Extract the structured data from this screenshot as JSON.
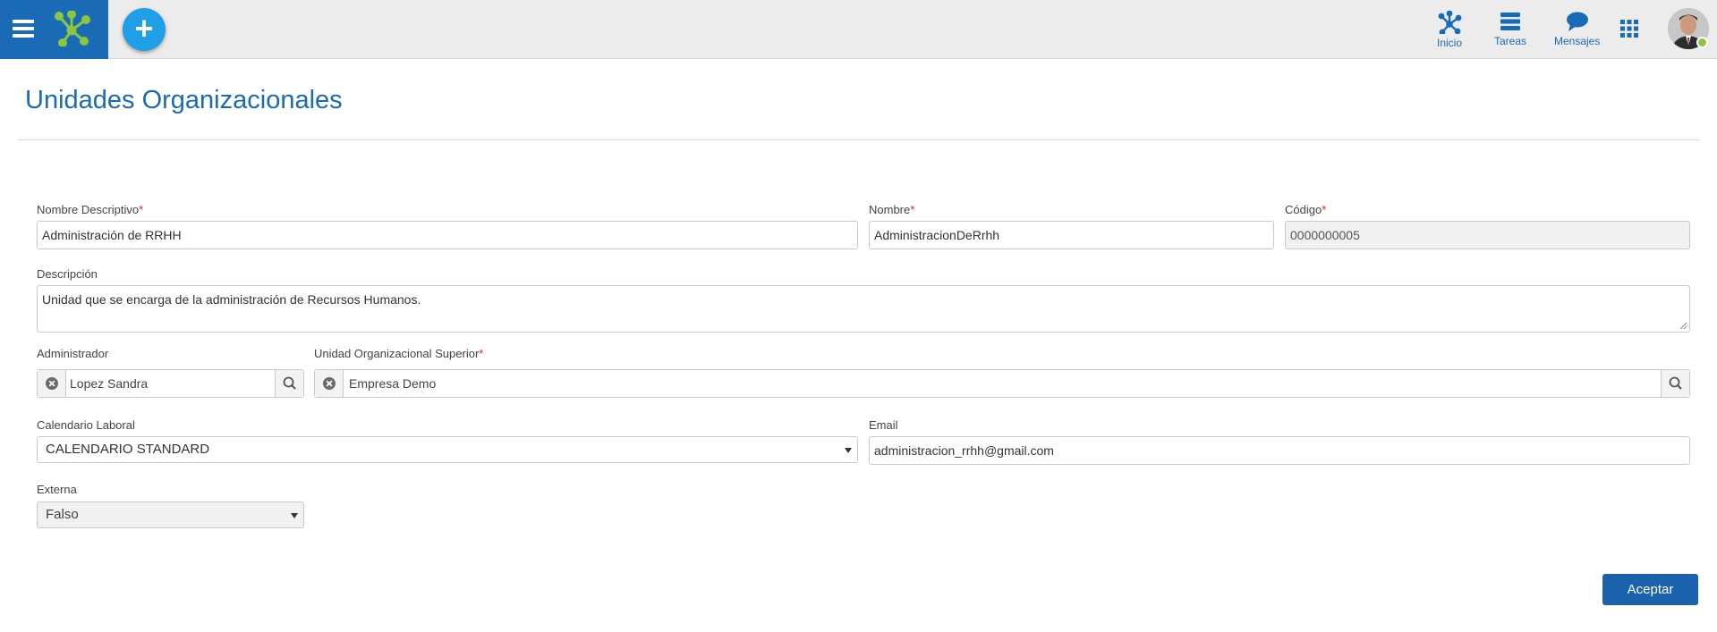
{
  "header": {
    "nav": [
      {
        "label": "Inicio",
        "icon": "nodes-icon"
      },
      {
        "label": "Tareas",
        "icon": "tasks-icon"
      },
      {
        "label": "Mensajes",
        "icon": "chat-icon"
      }
    ],
    "apps_icon": "grid-icon",
    "user_status": "online",
    "colors": {
      "brand": "#1a6bb5",
      "fab": "#1e9fe6",
      "status": "#8cc63f",
      "logo": "#8cc63f"
    }
  },
  "page": {
    "title": "Unidades Organizacionales"
  },
  "form": {
    "nombre_descriptivo": {
      "label": "Nombre Descriptivo",
      "value": "Administración de RRHH",
      "required": "*"
    },
    "nombre": {
      "label": "Nombre",
      "value": "AdministracionDeRrhh",
      "required": "*"
    },
    "codigo": {
      "label": "Código",
      "value": "0000000005",
      "required": "*"
    },
    "descripcion": {
      "label": "Descripción",
      "value": "Unidad que se encarga de la administración de Recursos Humanos."
    },
    "administrador": {
      "label": "Administrador",
      "value": "Lopez Sandra"
    },
    "unidad_superior": {
      "label": "Unidad Organizacional Superior",
      "value": "Empresa Demo",
      "required": "*"
    },
    "calendario": {
      "label": "Calendario Laboral",
      "value": "CALENDARIO STANDARD"
    },
    "email": {
      "label": "Email",
      "value": "administracion_rrhh@gmail.com"
    },
    "externa": {
      "label": "Externa",
      "value": "Falso"
    }
  },
  "actions": {
    "accept_label": "Aceptar"
  }
}
